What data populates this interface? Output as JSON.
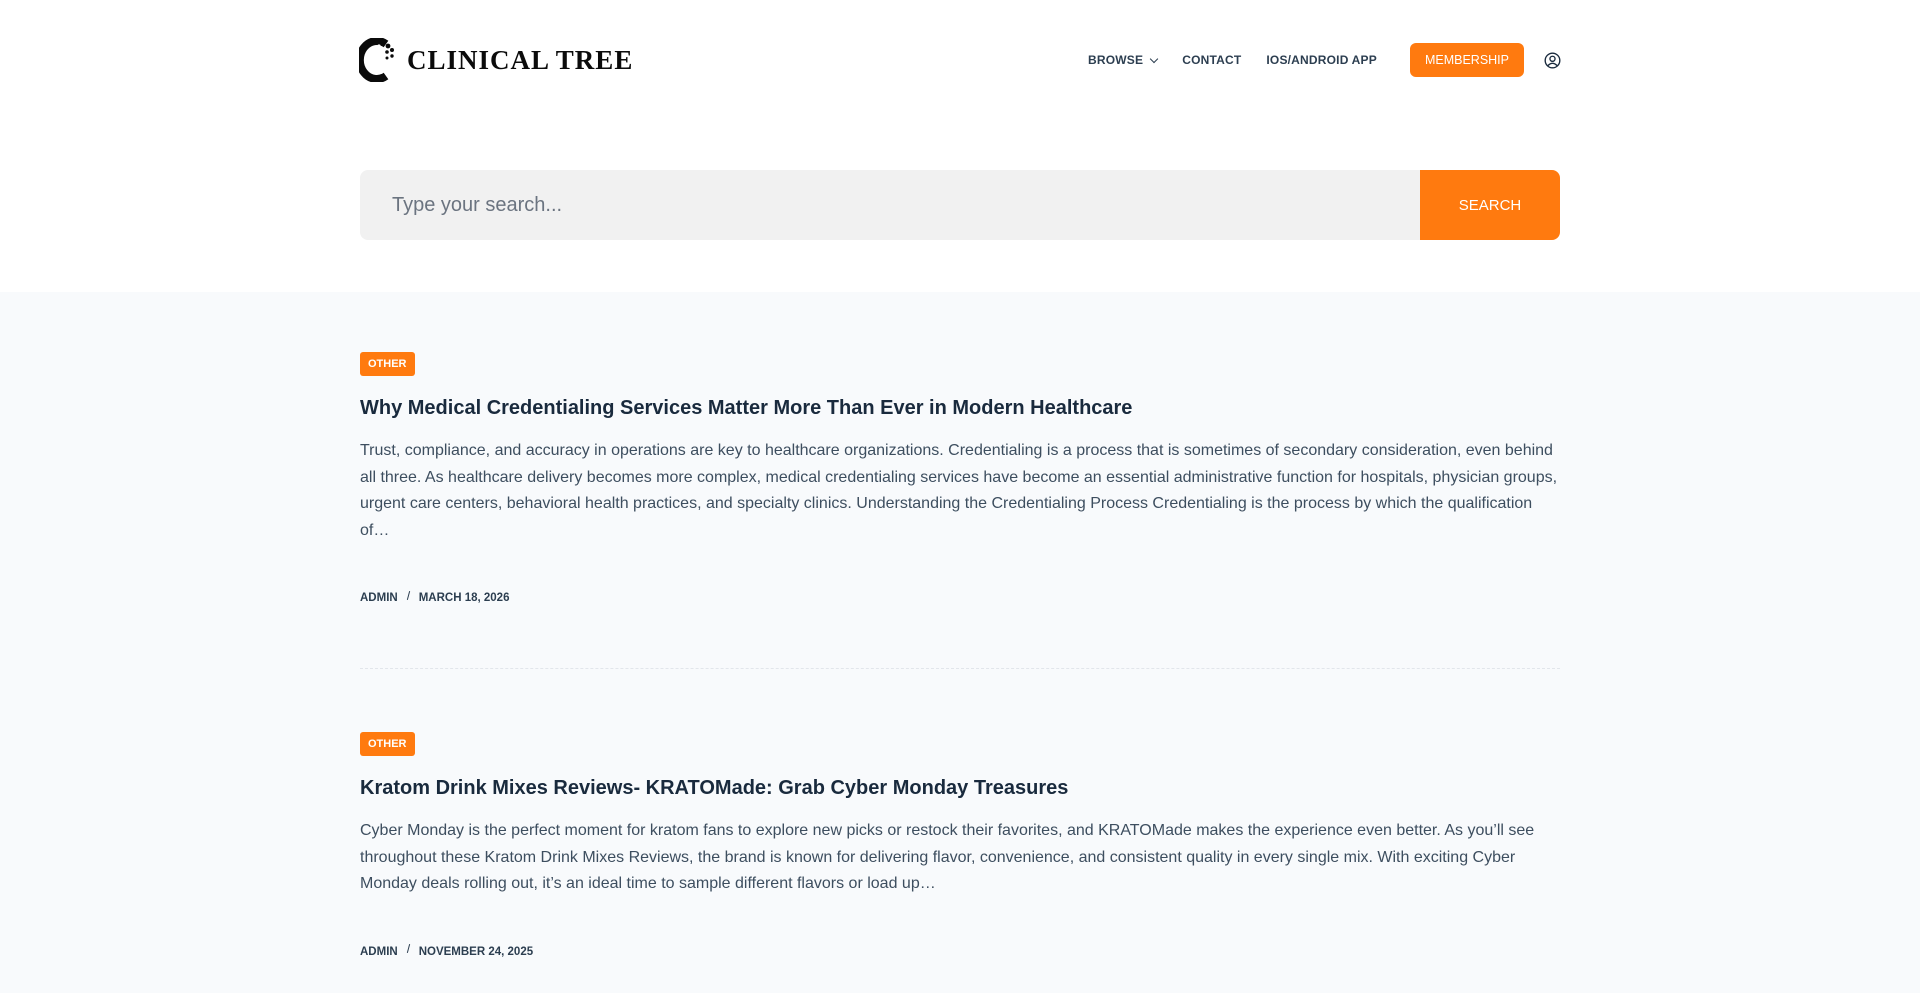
{
  "brand": {
    "name": "CLINICAL TREE"
  },
  "nav": {
    "items": [
      {
        "label": "BROWSE",
        "has_dropdown": true
      },
      {
        "label": "CONTACT",
        "has_dropdown": false
      },
      {
        "label": "IOS/ANDROID APP",
        "has_dropdown": false
      }
    ],
    "membership_label": "MEMBERSHIP",
    "account_icon": "user-circle-icon"
  },
  "search": {
    "placeholder": "Type your search...",
    "value": "",
    "button_label": "SEARCH"
  },
  "posts": [
    {
      "category": "OTHER",
      "title": "Why Medical Credentialing Services Matter More Than Ever in Modern Healthcare",
      "excerpt": "Trust, compliance, and accuracy in operations are key to healthcare organizations. Credentialing is a process that is sometimes of secondary consideration, even behind all three. As healthcare delivery becomes more complex, medical credentialing services have become an essential administrative function for hospitals, physician groups, urgent care centers, behavioral health practices, and specialty clinics. Understanding the Credentialing Process Credentialing is the process by which the qualification of…",
      "author": "ADMIN",
      "date": "MARCH 18, 2026"
    },
    {
      "category": "OTHER",
      "title": "Kratom Drink Mixes Reviews- KRATOMade: Grab Cyber Monday Treasures",
      "excerpt": "Cyber Monday is the perfect moment for kratom fans to explore new picks or restock their favorites, and KRATOMade makes the experience even better. As you’ll see throughout these Kratom Drink Mixes Reviews, the brand is known for delivering flavor, convenience, and consistent quality in every single mix. With exciting Cyber Monday deals rolling out, it’s an ideal time to sample different flavors or load up…",
      "author": "ADMIN",
      "date": "NOVEMBER 24, 2025"
    }
  ],
  "colors": {
    "accent": "#ff7a0f",
    "heading": "#192a3d",
    "text": "#3d4e5f",
    "content_bg": "#f8fafc"
  }
}
